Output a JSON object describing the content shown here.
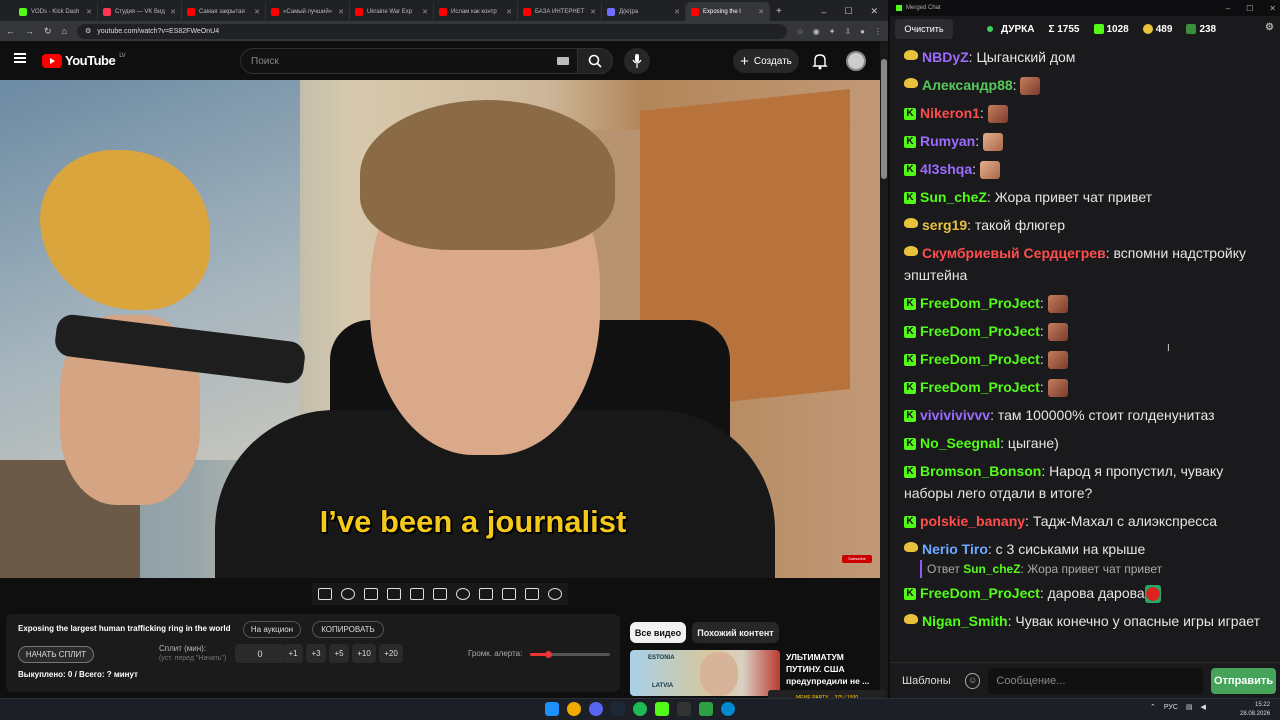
{
  "browser": {
    "tabs": [
      {
        "label": "VODs - Kick Dash",
        "color": "#53fc18",
        "active": false
      },
      {
        "label": "Студия — VK Вид",
        "color": "#ff3355",
        "active": false
      },
      {
        "label": "Самая закрытая",
        "color": "#ff0000",
        "active": false
      },
      {
        "label": "«Самый лучший»",
        "color": "#ff0000",
        "active": false
      },
      {
        "label": "Ukraine War Exp",
        "color": "#ff0000",
        "active": false
      },
      {
        "label": "Ислам как контр",
        "color": "#ff0000",
        "active": false
      },
      {
        "label": "БАЗА ИНТЕРНЕТ",
        "color": "#ff0000",
        "active": false
      },
      {
        "label": "Д(ю)ра",
        "color": "#6f6fff",
        "active": false
      },
      {
        "label": "Exposing the l",
        "color": "#ff0000",
        "active": true
      }
    ],
    "url": "youtube.com/watch?v=ES82FWeOnU4"
  },
  "youtube": {
    "logo_text": "YouTube",
    "country_code": "LV",
    "search_placeholder": "Поиск",
    "create_label": "Создать"
  },
  "video": {
    "subtitle": "I’ve been a journalist",
    "watermark": "Subscribe"
  },
  "panel": {
    "title": "Exposing the largest human trafficking ring in the world",
    "auction_label": "На аукцион",
    "copy_label": "КОПИРОВАТЬ",
    "start_split_label": "НАЧАТЬ СПЛИТ",
    "split_label": "Сплит (мин):",
    "split_hint": "(уст. перед \"Начать\")",
    "split_value": "0",
    "increments": [
      "+1",
      "+3",
      "+5",
      "+10",
      "+20"
    ],
    "bought_text": "Выкуплено: 0 / Всего: ? минут",
    "volume_label": "Громк. алерта:",
    "volume_fraction": 0.22
  },
  "recommendations": {
    "chips": [
      "Все видео",
      "Похожий контент"
    ],
    "thumb_labels": [
      "ESTONIA",
      "LATVIA"
    ],
    "title": "УЛЬТИМАТУМ ПУТИНУ. США предупредили не ...",
    "meme_label": "MEME PARTY",
    "meme_progress": "375 / 1500"
  },
  "chat": {
    "window_title": "Merged Chat",
    "clear_label": "Очистить",
    "channel": "ДУРКА",
    "stats": [
      {
        "label": "Σ 1755",
        "color": "#ffffff"
      },
      {
        "label": "1028",
        "color": "#53fc18"
      },
      {
        "label": "489",
        "color": "#e8c23a"
      },
      {
        "label": "238",
        "color": "#53fc18"
      }
    ],
    "messages": [
      {
        "badge": "tw",
        "user": "NBDyZ",
        "color": "#9d6bff",
        "text": "Цыганский дом"
      },
      {
        "badge": "tw",
        "user": "Александр88",
        "color": "#57c95c",
        "text": "",
        "emote": "dark"
      },
      {
        "badge": "k",
        "user": "Nikeron1",
        "color": "#ff4d4d",
        "text": "",
        "emote": "dark"
      },
      {
        "badge": "k",
        "user": "Rumyan",
        "color": "#9d6bff",
        "text": "",
        "emote": "light"
      },
      {
        "badge": "k",
        "user": "4l3shqa",
        "color": "#9d6bff",
        "text": "",
        "emote": "light"
      },
      {
        "badge": "k",
        "user": "Sun_cheZ",
        "color": "#53fc18",
        "text": "Жора привет чат привет"
      },
      {
        "badge": "tw",
        "user": "serg19",
        "color": "#e8c23a",
        "text": "такой флюгер"
      },
      {
        "badge": "tw",
        "user": "Скумбриевый Сердцегрев",
        "color": "#ff4d4d",
        "text": "вспомни надстройку эпштейна"
      },
      {
        "badge": "k",
        "user": "FreeDom_ProJect",
        "color": "#53fc18",
        "text": "",
        "emote": "dark"
      },
      {
        "badge": "k",
        "user": "FreeDom_ProJect",
        "color": "#53fc18",
        "text": "",
        "emote": "dark"
      },
      {
        "badge": "k",
        "user": "FreeDom_ProJect",
        "color": "#53fc18",
        "text": "",
        "emote": "dark"
      },
      {
        "badge": "k",
        "user": "FreeDom_ProJect",
        "color": "#53fc18",
        "text": "",
        "emote": "dark"
      },
      {
        "badge": "k",
        "user": "vivivivivvv",
        "color": "#9d6bff",
        "text": "там 100000% стоит голденунитаз"
      },
      {
        "badge": "k",
        "user": "No_Seegnal",
        "color": "#53fc18",
        "text": "цыгане)"
      },
      {
        "badge": "k",
        "user": "Bromson_Bonson",
        "color": "#53fc18",
        "text": "Народ я пропустил, чуваку наборы лего отдали в итоге?"
      },
      {
        "badge": "k",
        "user": "polskie_banany",
        "color": "#ff4d4d",
        "text": "Тадж-Махал с алиэкспресса"
      },
      {
        "badge": "tw",
        "user": "Nerio Tiro",
        "color": "#6ea8ff",
        "text": "с 3 сиськами на крыше",
        "reply_to": "Sun_cheZ",
        "reply_text": "Жора привет чат привет",
        "reply_prefix": "Ответ"
      },
      {
        "badge": "k",
        "user": "FreeDom_ProJect",
        "color": "#53fc18",
        "text": "дарова дарова",
        "emote": "straw"
      },
      {
        "badge": "tw",
        "user": "Nigan_Smith",
        "color": "#53fc18",
        "text": "Чувак конечно у опасные игры играет"
      }
    ],
    "templates_label": "Шаблоны",
    "message_placeholder": "Сообщение...",
    "send_label": "Отправить"
  },
  "taskbar": {
    "lang": "РУС",
    "time": "15:22",
    "date": "28.08.2026"
  }
}
